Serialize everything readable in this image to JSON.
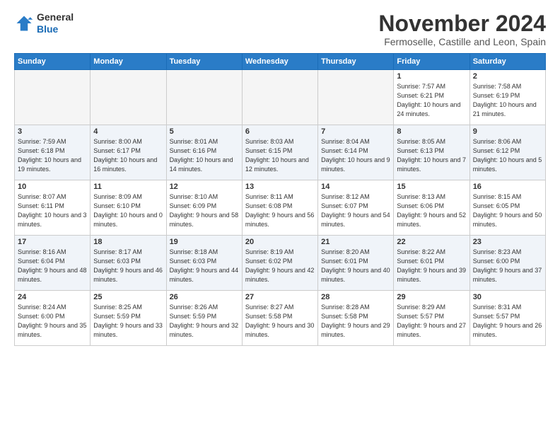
{
  "header": {
    "logo_general": "General",
    "logo_blue": "Blue",
    "month": "November 2024",
    "location": "Fermoselle, Castille and Leon, Spain"
  },
  "days_of_week": [
    "Sunday",
    "Monday",
    "Tuesday",
    "Wednesday",
    "Thursday",
    "Friday",
    "Saturday"
  ],
  "weeks": [
    [
      {
        "num": "",
        "empty": true
      },
      {
        "num": "",
        "empty": true
      },
      {
        "num": "",
        "empty": true
      },
      {
        "num": "",
        "empty": true
      },
      {
        "num": "",
        "empty": true
      },
      {
        "num": "1",
        "sunrise": "Sunrise: 7:57 AM",
        "sunset": "Sunset: 6:21 PM",
        "daylight": "Daylight: 10 hours and 24 minutes."
      },
      {
        "num": "2",
        "sunrise": "Sunrise: 7:58 AM",
        "sunset": "Sunset: 6:19 PM",
        "daylight": "Daylight: 10 hours and 21 minutes."
      }
    ],
    [
      {
        "num": "3",
        "sunrise": "Sunrise: 7:59 AM",
        "sunset": "Sunset: 6:18 PM",
        "daylight": "Daylight: 10 hours and 19 minutes."
      },
      {
        "num": "4",
        "sunrise": "Sunrise: 8:00 AM",
        "sunset": "Sunset: 6:17 PM",
        "daylight": "Daylight: 10 hours and 16 minutes."
      },
      {
        "num": "5",
        "sunrise": "Sunrise: 8:01 AM",
        "sunset": "Sunset: 6:16 PM",
        "daylight": "Daylight: 10 hours and 14 minutes."
      },
      {
        "num": "6",
        "sunrise": "Sunrise: 8:03 AM",
        "sunset": "Sunset: 6:15 PM",
        "daylight": "Daylight: 10 hours and 12 minutes."
      },
      {
        "num": "7",
        "sunrise": "Sunrise: 8:04 AM",
        "sunset": "Sunset: 6:14 PM",
        "daylight": "Daylight: 10 hours and 9 minutes."
      },
      {
        "num": "8",
        "sunrise": "Sunrise: 8:05 AM",
        "sunset": "Sunset: 6:13 PM",
        "daylight": "Daylight: 10 hours and 7 minutes."
      },
      {
        "num": "9",
        "sunrise": "Sunrise: 8:06 AM",
        "sunset": "Sunset: 6:12 PM",
        "daylight": "Daylight: 10 hours and 5 minutes."
      }
    ],
    [
      {
        "num": "10",
        "sunrise": "Sunrise: 8:07 AM",
        "sunset": "Sunset: 6:11 PM",
        "daylight": "Daylight: 10 hours and 3 minutes."
      },
      {
        "num": "11",
        "sunrise": "Sunrise: 8:09 AM",
        "sunset": "Sunset: 6:10 PM",
        "daylight": "Daylight: 10 hours and 0 minutes."
      },
      {
        "num": "12",
        "sunrise": "Sunrise: 8:10 AM",
        "sunset": "Sunset: 6:09 PM",
        "daylight": "Daylight: 9 hours and 58 minutes."
      },
      {
        "num": "13",
        "sunrise": "Sunrise: 8:11 AM",
        "sunset": "Sunset: 6:08 PM",
        "daylight": "Daylight: 9 hours and 56 minutes."
      },
      {
        "num": "14",
        "sunrise": "Sunrise: 8:12 AM",
        "sunset": "Sunset: 6:07 PM",
        "daylight": "Daylight: 9 hours and 54 minutes."
      },
      {
        "num": "15",
        "sunrise": "Sunrise: 8:13 AM",
        "sunset": "Sunset: 6:06 PM",
        "daylight": "Daylight: 9 hours and 52 minutes."
      },
      {
        "num": "16",
        "sunrise": "Sunrise: 8:15 AM",
        "sunset": "Sunset: 6:05 PM",
        "daylight": "Daylight: 9 hours and 50 minutes."
      }
    ],
    [
      {
        "num": "17",
        "sunrise": "Sunrise: 8:16 AM",
        "sunset": "Sunset: 6:04 PM",
        "daylight": "Daylight: 9 hours and 48 minutes."
      },
      {
        "num": "18",
        "sunrise": "Sunrise: 8:17 AM",
        "sunset": "Sunset: 6:03 PM",
        "daylight": "Daylight: 9 hours and 46 minutes."
      },
      {
        "num": "19",
        "sunrise": "Sunrise: 8:18 AM",
        "sunset": "Sunset: 6:03 PM",
        "daylight": "Daylight: 9 hours and 44 minutes."
      },
      {
        "num": "20",
        "sunrise": "Sunrise: 8:19 AM",
        "sunset": "Sunset: 6:02 PM",
        "daylight": "Daylight: 9 hours and 42 minutes."
      },
      {
        "num": "21",
        "sunrise": "Sunrise: 8:20 AM",
        "sunset": "Sunset: 6:01 PM",
        "daylight": "Daylight: 9 hours and 40 minutes."
      },
      {
        "num": "22",
        "sunrise": "Sunrise: 8:22 AM",
        "sunset": "Sunset: 6:01 PM",
        "daylight": "Daylight: 9 hours and 39 minutes."
      },
      {
        "num": "23",
        "sunrise": "Sunrise: 8:23 AM",
        "sunset": "Sunset: 6:00 PM",
        "daylight": "Daylight: 9 hours and 37 minutes."
      }
    ],
    [
      {
        "num": "24",
        "sunrise": "Sunrise: 8:24 AM",
        "sunset": "Sunset: 6:00 PM",
        "daylight": "Daylight: 9 hours and 35 minutes."
      },
      {
        "num": "25",
        "sunrise": "Sunrise: 8:25 AM",
        "sunset": "Sunset: 5:59 PM",
        "daylight": "Daylight: 9 hours and 33 minutes."
      },
      {
        "num": "26",
        "sunrise": "Sunrise: 8:26 AM",
        "sunset": "Sunset: 5:59 PM",
        "daylight": "Daylight: 9 hours and 32 minutes."
      },
      {
        "num": "27",
        "sunrise": "Sunrise: 8:27 AM",
        "sunset": "Sunset: 5:58 PM",
        "daylight": "Daylight: 9 hours and 30 minutes."
      },
      {
        "num": "28",
        "sunrise": "Sunrise: 8:28 AM",
        "sunset": "Sunset: 5:58 PM",
        "daylight": "Daylight: 9 hours and 29 minutes."
      },
      {
        "num": "29",
        "sunrise": "Sunrise: 8:29 AM",
        "sunset": "Sunset: 5:57 PM",
        "daylight": "Daylight: 9 hours and 27 minutes."
      },
      {
        "num": "30",
        "sunrise": "Sunrise: 8:31 AM",
        "sunset": "Sunset: 5:57 PM",
        "daylight": "Daylight: 9 hours and 26 minutes."
      }
    ]
  ]
}
